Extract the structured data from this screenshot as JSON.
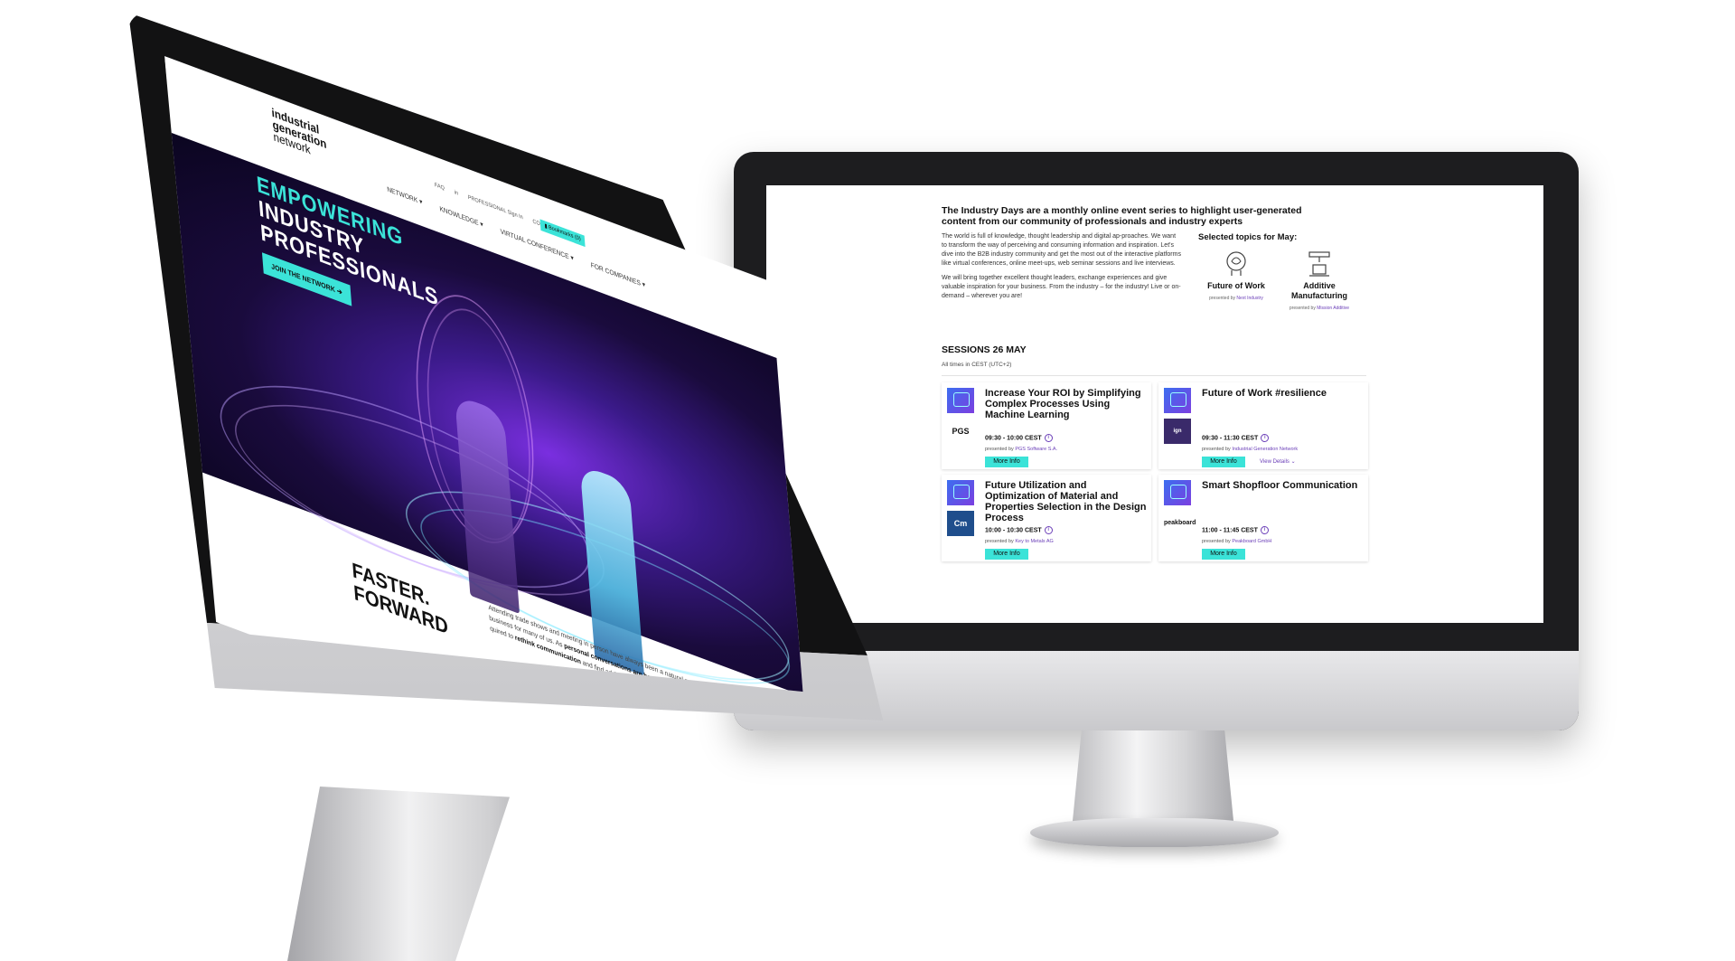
{
  "back_screen": {
    "intro_title": "The Industry Days are a monthly online event series to highlight user-generated content from our community of professionals and industry experts",
    "intro_p1": "The world is full of knowledge, thought leadership and digital ap-proaches. We want to transform the way of perceiving and consuming information and inspiration. Let's dive into the B2B industry community and get the most out of the interactive platforms like virtual conferences, online meet-ups, web seminar sessions and live interviews.",
    "intro_p2": "We will bring together excellent thought leaders, exchange experiences and give valuable inspiration for your business. From the industry – for the industry! Live or on-demand – wherever you are!",
    "topics_heading": "Selected topics for May:",
    "topics": [
      {
        "name": "Future of Work",
        "presented_prefix": "presented by",
        "presenter": "Next Industry",
        "icon": "brain-head-icon"
      },
      {
        "name": "Additive Manufacturing",
        "presented_prefix": "presented by",
        "presenter": "Mission Additive",
        "icon": "3d-printer-icon"
      }
    ],
    "sessions_heading": "SESSIONS 26 MAY",
    "times_note": "All times in CEST (UTC+2)",
    "sessions": [
      {
        "title": "Increase Your ROI by Simplifying Complex Processes Using Machine Learning",
        "time": "09:30 - 10:00 CEST",
        "presented_prefix": "presented by",
        "presenter": "PGS Software S.A.",
        "logo": "PGS",
        "button": "More Info",
        "details": ""
      },
      {
        "title": "Future of Work #resilience",
        "time": "09:30 - 11:30 CEST",
        "presented_prefix": "presented by",
        "presenter": "Industrial Generation Network",
        "logo": "ign",
        "button": "More Info",
        "details": "View Details"
      },
      {
        "title": "Future Utilization and Optimization of Material and Properties Selection in the Design Process",
        "time": "10:00 - 10:30 CEST",
        "presented_prefix": "presented by",
        "presenter": "Key to Metals AG",
        "logo": "Cm",
        "button": "More Info",
        "details": ""
      },
      {
        "title": "Smart Shopfloor Communication",
        "time": "11:00 - 11:45 CEST",
        "presented_prefix": "presented by",
        "presenter": "Peakboard GmbH",
        "logo": "peakboard",
        "button": "More Info",
        "details": ""
      }
    ]
  },
  "front_screen": {
    "logo_lines": [
      "industrial",
      "generation",
      "network"
    ],
    "topbar": [
      "FAQ",
      "in",
      "PROFESSIONAL Sign In",
      "COMPANY Sign In"
    ],
    "bookmarks": "Bookmarks (0)",
    "nav": [
      "NETWORK",
      "KNOWLEDGE",
      "VIRTUAL CONFERENCE",
      "FOR COMPANIES"
    ],
    "hero_line1": "EMPOWERING",
    "hero_line2": "INDUSTRY PROFESSIONALS",
    "join_button": "JOIN THE NETWORK ➔",
    "faster": "FASTER.",
    "forward": "FORWARD",
    "para_start": "Attending trade shows and meeting in person have always been a natural part of daily business for many of us. As ",
    "para_bold1": "personal conversations are becoming difficult",
    "para_mid": ", we are re-quired to ",
    "para_bold2": "rethink communication",
    "para_end": " and find additional ways to keep our partners close."
  },
  "colors": {
    "accent": "#3be3d8",
    "purple": "#6b3fb8",
    "hero_dark": "#1a0b3d"
  }
}
